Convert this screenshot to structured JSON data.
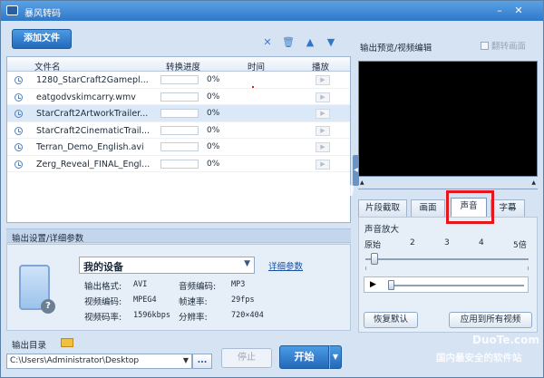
{
  "window": {
    "title": "暴风转码"
  },
  "toolbar": {
    "add_file": "添加文件"
  },
  "list": {
    "headers": {
      "name": "文件名",
      "progress": "转换进度",
      "time": "时间",
      "play": "播放"
    },
    "rows": [
      {
        "name": "1280_StarCraft2Gamepl...",
        "progress": "0%",
        "selected": false
      },
      {
        "name": "eatgodvskimcarry.wmv",
        "progress": "0%",
        "selected": false
      },
      {
        "name": "StarCraft2ArtworkTrailer...",
        "progress": "0%",
        "selected": true
      },
      {
        "name": "StarCraft2CinematicTrail...",
        "progress": "0%",
        "selected": false
      },
      {
        "name": "Terran_Demo_English.avi",
        "progress": "0%",
        "selected": false
      },
      {
        "name": "Zerg_Reveal_FINAL_Engl...",
        "progress": "0%",
        "selected": false
      }
    ]
  },
  "settings": {
    "title": "输出设置/详细参数",
    "device": "我的设备",
    "detail_link": "详细参数",
    "format_label": "输出格式:",
    "format_value": "AVI",
    "audio_codec_label": "音频编码:",
    "audio_codec_value": "MP3",
    "video_codec_label": "视频编码:",
    "video_codec_value": "MPEG4",
    "fps_label": "帧速率:",
    "fps_value": "29fps",
    "bitrate_label": "视频码率:",
    "bitrate_value": "1596kbps",
    "resolution_label": "分辨率:",
    "resolution_value": "720×404"
  },
  "output": {
    "dir_label": "输出目录",
    "path": "C:\\Users\\Administrator\\Desktop",
    "browse": "...",
    "stop": "停止",
    "start": "开始"
  },
  "preview": {
    "title": "输出预览/视频编辑",
    "flip": "翻转画面",
    "tabs": [
      "片段截取",
      "画面",
      "声音",
      "字幕"
    ],
    "active_tab": "声音",
    "amplify_label": "声音放大",
    "scale": [
      "原始",
      "2",
      "3",
      "4",
      "5倍"
    ],
    "restore": "恢复默认",
    "apply_all": "应用到所有视频"
  },
  "watermark": {
    "site": "www.DuoTe.com",
    "logo": "DuoTe.com",
    "slogan": "国内最安全的软件站"
  },
  "colors": {
    "accent": "#2f78c8",
    "highlight_box": "#e5161c"
  }
}
